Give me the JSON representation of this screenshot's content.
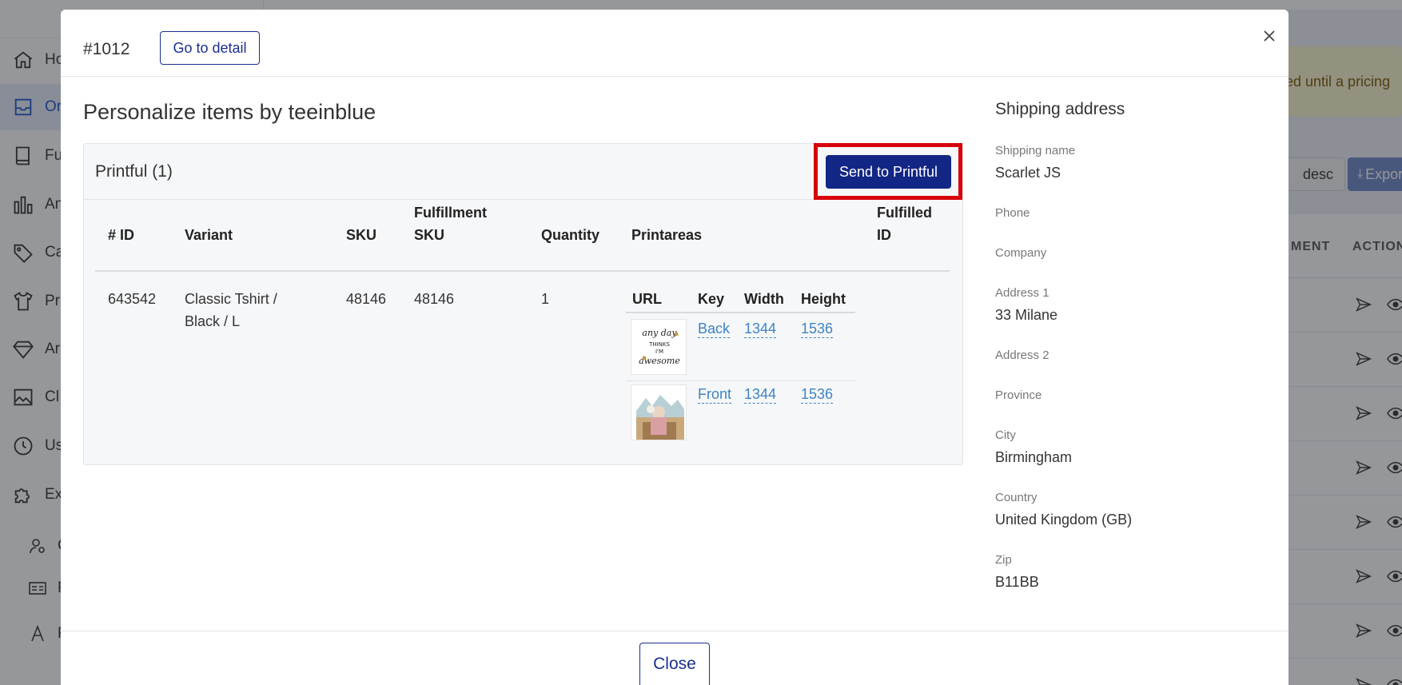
{
  "sidebar": {
    "items": [
      {
        "label": "Ho",
        "icon": "home-icon"
      },
      {
        "label": "Or",
        "icon": "inbox-icon",
        "active": true
      },
      {
        "label": "Fu",
        "icon": "book-icon"
      },
      {
        "label": "An",
        "icon": "bar-chart-icon"
      },
      {
        "label": "Ca",
        "icon": "tag-icon"
      },
      {
        "label": "Pr",
        "icon": "tshirt-icon"
      },
      {
        "label": "Ar",
        "icon": "diamond-icon"
      },
      {
        "label": "Cl",
        "icon": "image-icon"
      },
      {
        "label": "Us",
        "icon": "history-icon"
      },
      {
        "label": "Ex",
        "icon": "puzzle-icon"
      }
    ],
    "sub_items": [
      {
        "label": "C",
        "icon": "user-gear-icon"
      },
      {
        "label": "F",
        "icon": "id-card-icon"
      },
      {
        "label": "F",
        "icon": "letter-a-icon"
      }
    ]
  },
  "background": {
    "banner_text": "ed until a pricing",
    "sort_label": "desc",
    "export_label": "Export",
    "col_fulfillment": "MENT",
    "col_action": "ACTION"
  },
  "modal": {
    "order_number": "#1012",
    "detail_label": "Go to detail",
    "section_title": "Personalize items by teeinblue",
    "card_title": "Printful (1)",
    "send_label": "Send to Printful",
    "headers": {
      "id": "# ID",
      "variant": "Variant",
      "sku": "SKU",
      "fulfillment_sku_1": "Fulfillment",
      "fulfillment_sku_2": "SKU",
      "quantity": "Quantity",
      "printareas": "Printareas",
      "fulfilled_id_1": "Fulfilled",
      "fulfilled_id_2": "ID"
    },
    "row": {
      "id": "643542",
      "variant_1": "Classic Tshirt /",
      "variant_2": "Black / L",
      "sku": "48146",
      "fulfillment_sku": "48146",
      "quantity": "1"
    },
    "printareas": {
      "headers": {
        "url": "URL",
        "key": "Key",
        "width": "Width",
        "height": "Height"
      },
      "rows": [
        {
          "key": "Back",
          "width": "1344",
          "height": "1536"
        },
        {
          "key": "Front",
          "width": "1344",
          "height": "1536"
        }
      ],
      "thumb_text": [
        "any day",
        "THINKS",
        "I'M",
        "awesome"
      ]
    },
    "shipping": {
      "title": "Shipping address",
      "fields": [
        {
          "label": "Shipping name",
          "value": "Scarlet JS"
        },
        {
          "label": "Phone",
          "value": ""
        },
        {
          "label": "Company",
          "value": ""
        },
        {
          "label": "Address 1",
          "value": "33 Milane"
        },
        {
          "label": "Address 2",
          "value": ""
        },
        {
          "label": "Province",
          "value": ""
        },
        {
          "label": "City",
          "value": "Birmingham"
        },
        {
          "label": "Country",
          "value": "United Kingdom (GB)"
        },
        {
          "label": "Zip",
          "value": "B11BB"
        }
      ]
    },
    "close_label": "Close"
  },
  "colors": {
    "primary": "#122685",
    "highlight": "#d8000a",
    "link": "#3d84c6",
    "banner": "#fcf3cf"
  }
}
